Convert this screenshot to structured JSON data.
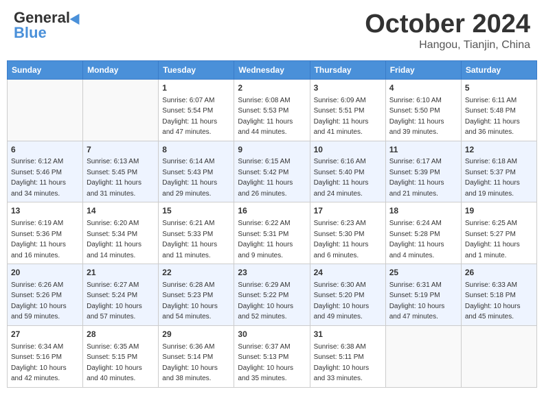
{
  "header": {
    "logo_general": "General",
    "logo_blue": "Blue",
    "month": "October 2024",
    "location": "Hangou, Tianjin, China"
  },
  "days_of_week": [
    "Sunday",
    "Monday",
    "Tuesday",
    "Wednesday",
    "Thursday",
    "Friday",
    "Saturday"
  ],
  "weeks": [
    [
      {
        "day": "",
        "info": ""
      },
      {
        "day": "",
        "info": ""
      },
      {
        "day": "1",
        "info": "Sunrise: 6:07 AM\nSunset: 5:54 PM\nDaylight: 11 hours and 47 minutes."
      },
      {
        "day": "2",
        "info": "Sunrise: 6:08 AM\nSunset: 5:53 PM\nDaylight: 11 hours and 44 minutes."
      },
      {
        "day": "3",
        "info": "Sunrise: 6:09 AM\nSunset: 5:51 PM\nDaylight: 11 hours and 41 minutes."
      },
      {
        "day": "4",
        "info": "Sunrise: 6:10 AM\nSunset: 5:50 PM\nDaylight: 11 hours and 39 minutes."
      },
      {
        "day": "5",
        "info": "Sunrise: 6:11 AM\nSunset: 5:48 PM\nDaylight: 11 hours and 36 minutes."
      }
    ],
    [
      {
        "day": "6",
        "info": "Sunrise: 6:12 AM\nSunset: 5:46 PM\nDaylight: 11 hours and 34 minutes."
      },
      {
        "day": "7",
        "info": "Sunrise: 6:13 AM\nSunset: 5:45 PM\nDaylight: 11 hours and 31 minutes."
      },
      {
        "day": "8",
        "info": "Sunrise: 6:14 AM\nSunset: 5:43 PM\nDaylight: 11 hours and 29 minutes."
      },
      {
        "day": "9",
        "info": "Sunrise: 6:15 AM\nSunset: 5:42 PM\nDaylight: 11 hours and 26 minutes."
      },
      {
        "day": "10",
        "info": "Sunrise: 6:16 AM\nSunset: 5:40 PM\nDaylight: 11 hours and 24 minutes."
      },
      {
        "day": "11",
        "info": "Sunrise: 6:17 AM\nSunset: 5:39 PM\nDaylight: 11 hours and 21 minutes."
      },
      {
        "day": "12",
        "info": "Sunrise: 6:18 AM\nSunset: 5:37 PM\nDaylight: 11 hours and 19 minutes."
      }
    ],
    [
      {
        "day": "13",
        "info": "Sunrise: 6:19 AM\nSunset: 5:36 PM\nDaylight: 11 hours and 16 minutes."
      },
      {
        "day": "14",
        "info": "Sunrise: 6:20 AM\nSunset: 5:34 PM\nDaylight: 11 hours and 14 minutes."
      },
      {
        "day": "15",
        "info": "Sunrise: 6:21 AM\nSunset: 5:33 PM\nDaylight: 11 hours and 11 minutes."
      },
      {
        "day": "16",
        "info": "Sunrise: 6:22 AM\nSunset: 5:31 PM\nDaylight: 11 hours and 9 minutes."
      },
      {
        "day": "17",
        "info": "Sunrise: 6:23 AM\nSunset: 5:30 PM\nDaylight: 11 hours and 6 minutes."
      },
      {
        "day": "18",
        "info": "Sunrise: 6:24 AM\nSunset: 5:28 PM\nDaylight: 11 hours and 4 minutes."
      },
      {
        "day": "19",
        "info": "Sunrise: 6:25 AM\nSunset: 5:27 PM\nDaylight: 11 hours and 1 minute."
      }
    ],
    [
      {
        "day": "20",
        "info": "Sunrise: 6:26 AM\nSunset: 5:26 PM\nDaylight: 10 hours and 59 minutes."
      },
      {
        "day": "21",
        "info": "Sunrise: 6:27 AM\nSunset: 5:24 PM\nDaylight: 10 hours and 57 minutes."
      },
      {
        "day": "22",
        "info": "Sunrise: 6:28 AM\nSunset: 5:23 PM\nDaylight: 10 hours and 54 minutes."
      },
      {
        "day": "23",
        "info": "Sunrise: 6:29 AM\nSunset: 5:22 PM\nDaylight: 10 hours and 52 minutes."
      },
      {
        "day": "24",
        "info": "Sunrise: 6:30 AM\nSunset: 5:20 PM\nDaylight: 10 hours and 49 minutes."
      },
      {
        "day": "25",
        "info": "Sunrise: 6:31 AM\nSunset: 5:19 PM\nDaylight: 10 hours and 47 minutes."
      },
      {
        "day": "26",
        "info": "Sunrise: 6:33 AM\nSunset: 5:18 PM\nDaylight: 10 hours and 45 minutes."
      }
    ],
    [
      {
        "day": "27",
        "info": "Sunrise: 6:34 AM\nSunset: 5:16 PM\nDaylight: 10 hours and 42 minutes."
      },
      {
        "day": "28",
        "info": "Sunrise: 6:35 AM\nSunset: 5:15 PM\nDaylight: 10 hours and 40 minutes."
      },
      {
        "day": "29",
        "info": "Sunrise: 6:36 AM\nSunset: 5:14 PM\nDaylight: 10 hours and 38 minutes."
      },
      {
        "day": "30",
        "info": "Sunrise: 6:37 AM\nSunset: 5:13 PM\nDaylight: 10 hours and 35 minutes."
      },
      {
        "day": "31",
        "info": "Sunrise: 6:38 AM\nSunset: 5:11 PM\nDaylight: 10 hours and 33 minutes."
      },
      {
        "day": "",
        "info": ""
      },
      {
        "day": "",
        "info": ""
      }
    ]
  ]
}
